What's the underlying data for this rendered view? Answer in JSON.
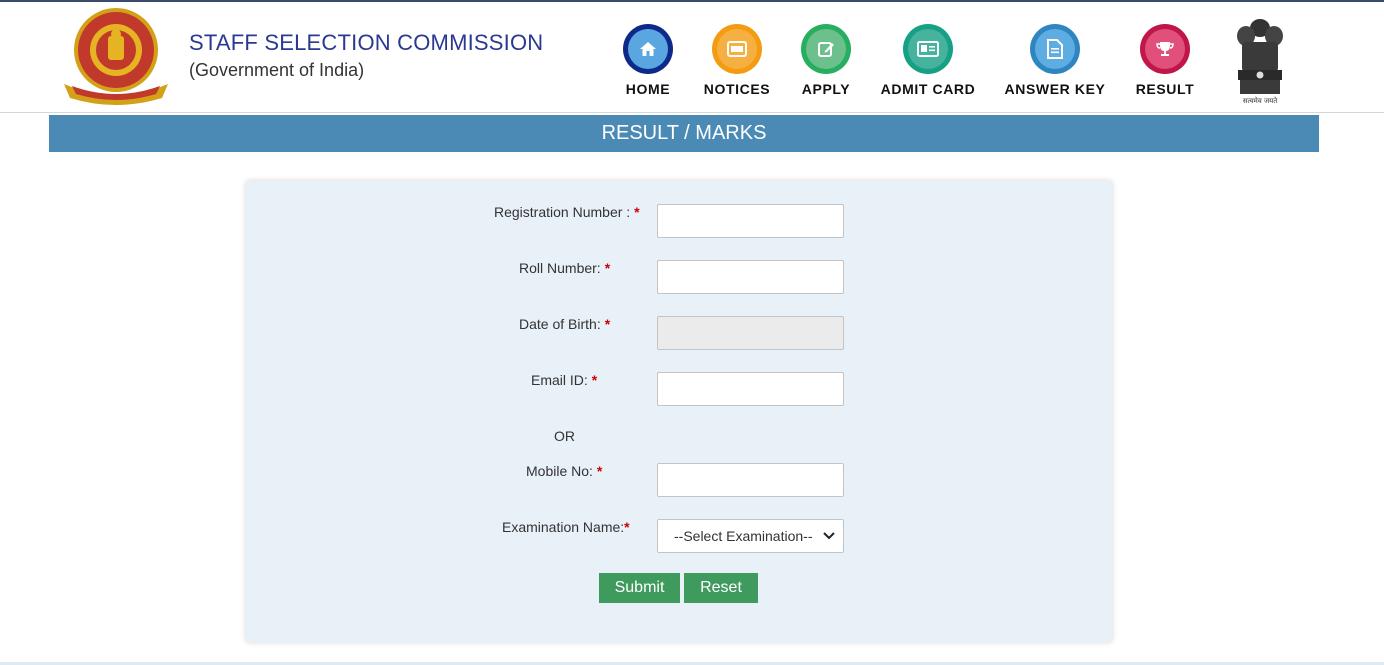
{
  "header": {
    "title": "STAFF SELECTION COMMISSION",
    "subtitle": "(Government of India)",
    "emblem_caption": "सत्यमेव जयते"
  },
  "nav": [
    {
      "label": "HOME",
      "icon": "home-icon",
      "color": "#0d2a8a",
      "inner": "#5aa6e0"
    },
    {
      "label": "NOTICES",
      "icon": "notice-icon",
      "color": "#f39c12",
      "inner": "#f5b041"
    },
    {
      "label": "APPLY",
      "icon": "edit-icon",
      "color": "#27ae60",
      "inner": "#6cc08b"
    },
    {
      "label": "ADMIT CARD",
      "icon": "id-card-icon",
      "color": "#16a085",
      "inner": "#45b39d"
    },
    {
      "label": "ANSWER KEY",
      "icon": "document-icon",
      "color": "#2e86c1",
      "inner": "#5dade2"
    },
    {
      "label": "RESULT",
      "icon": "trophy-icon",
      "color": "#c0164a",
      "inner": "#e0507a"
    }
  ],
  "banner": {
    "title": "RESULT / MARKS"
  },
  "form": {
    "registration_label": "Registration Number :",
    "roll_label": "Roll Number:",
    "dob_label": "Date of Birth:",
    "email_label": "Email ID:",
    "or_text": "OR",
    "mobile_label": "Mobile No:",
    "exam_label": "Examination Name:",
    "required_mark": "*",
    "exam_select_value": "--Select Examination--",
    "submit_label": "Submit",
    "reset_label": "Reset"
  },
  "colors": {
    "brand": "#2b3990",
    "banner": "#4a8ab5",
    "button": "#3f9a5e",
    "required": "#d00000"
  }
}
